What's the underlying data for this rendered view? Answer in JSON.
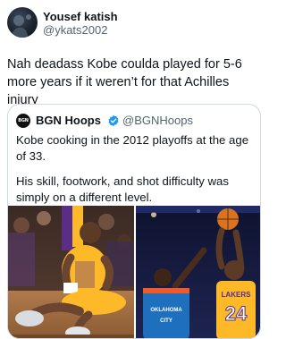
{
  "tweet": {
    "author": {
      "display_name": "Yousef katish",
      "handle": "@ykats2002"
    },
    "text": "Nah deadass Kobe coulda played for 5-6 more years if it weren’t for that Achilles injury"
  },
  "quoted_tweet": {
    "author": {
      "display_name": "BGN Hoops",
      "handle": "@BGNHoops",
      "logo_text": "BGN",
      "verified_color": "#1d9bf0"
    },
    "paragraph_1": "Kobe cooking in the 2012 playoffs at the age of 33.",
    "paragraph_2": "His skill, footwork, and shot difficulty was simply on a different level.",
    "media": [
      {
        "description_icon": "injured-player-photo"
      },
      {
        "description_icon": "jump-shot-photo",
        "jersey_number": "24",
        "jersey_team": "LAKERS",
        "opponent_jersey": "OKLAHOMA CITY"
      }
    ]
  }
}
